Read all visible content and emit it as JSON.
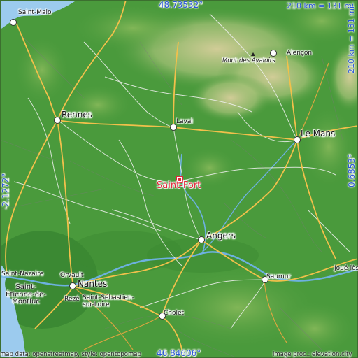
{
  "map": {
    "place": "Saint-Fort",
    "lat_top": "48.73532°",
    "lat_bottom": "46.84606°",
    "lon_left": "-2.1272°",
    "lon_right": "0.6853°",
    "scale_horizontal": "210 km = 131 mi",
    "scale_vertical": "210 km = 131 mi",
    "credit_left": "map data: openstreetmap, style: opentopomap",
    "credit_right": "image proc.: elevation.city",
    "colors": {
      "lowland": "#4a9a3c",
      "highland": "#c8d39a",
      "water": "#9ccbee",
      "motorway": "#f2c04b",
      "road": "#ffffff",
      "target": "#e4263a",
      "coord_text": "#2a56d8"
    },
    "cities": [
      {
        "name": "Saint-Malo"
      },
      {
        "name": "Rennes"
      },
      {
        "name": "Laval"
      },
      {
        "name": "Le Mans"
      },
      {
        "name": "Alençon"
      },
      {
        "name": "Angers"
      },
      {
        "name": "Saumur"
      },
      {
        "name": "Nantes"
      },
      {
        "name": "Orvault"
      },
      {
        "name": "Saint-Nazaire"
      },
      {
        "name": "Saint-Étienne-de-Montluc"
      },
      {
        "name": "Rezé"
      },
      {
        "name": "Saint-Sébastien-sur-Loire"
      },
      {
        "name": "Cholet"
      },
      {
        "name": "Joué-lès-Tours"
      }
    ],
    "peak": "Mont des Avaloirs"
  }
}
